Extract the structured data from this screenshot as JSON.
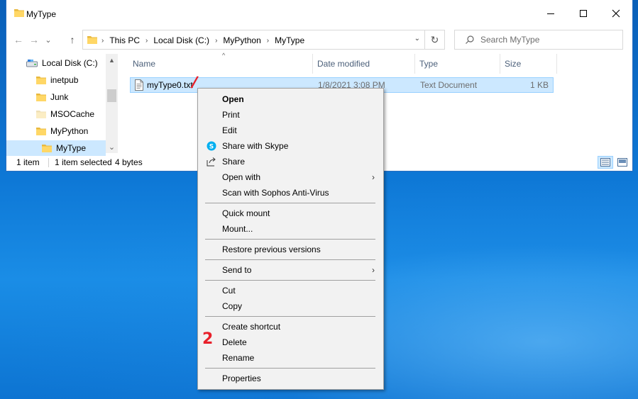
{
  "window": {
    "title": "MyType",
    "controls": {
      "minimize": "—",
      "maximize": "☐",
      "close": "✕"
    }
  },
  "nav": {
    "back": "←",
    "forward": "→",
    "recent": "⌄",
    "up": "↑",
    "breadcrumbs": [
      "This PC",
      "Local Disk (C:)",
      "MyPython",
      "MyType"
    ],
    "breadcrumb_sep": "›",
    "address_dropdown": "⌄",
    "refresh": "↻"
  },
  "search": {
    "placeholder": "Search MyType",
    "value": ""
  },
  "tree": {
    "items": [
      {
        "label": "Local Disk (C:)",
        "type": "drive"
      },
      {
        "label": "inetpub",
        "type": "folder"
      },
      {
        "label": "Junk",
        "type": "folder"
      },
      {
        "label": "MSOCache",
        "type": "folder"
      },
      {
        "label": "MyPython",
        "type": "folder"
      },
      {
        "label": "MyType",
        "type": "folder",
        "selected": true
      }
    ],
    "scroll_up": "▲",
    "scroll_down": "⌄"
  },
  "columns": {
    "name": "Name",
    "date": "Date modified",
    "type": "Type",
    "size": "Size",
    "sort_indicator": "^"
  },
  "files": [
    {
      "name": "myType0.txt",
      "date": "1/8/2021 3:08 PM",
      "type": "Text Document",
      "size": "1 KB"
    }
  ],
  "status": {
    "count": "1 item",
    "selection": "1 item selected",
    "bytes": "4 bytes"
  },
  "context_menu": {
    "open": "Open",
    "print": "Print",
    "edit": "Edit",
    "share_skype": "Share with Skype",
    "share": "Share",
    "open_with": "Open with",
    "scan": "Scan with Sophos Anti-Virus",
    "quick_mount": "Quick mount",
    "mount": "Mount...",
    "restore": "Restore previous versions",
    "send_to": "Send to",
    "cut": "Cut",
    "copy": "Copy",
    "create_shortcut": "Create shortcut",
    "delete": "Delete",
    "rename": "Rename",
    "properties": "Properties",
    "submenu_arrow": "›"
  },
  "annotations": {
    "step1": "/",
    "step2": "2"
  },
  "colors": {
    "selection": "#cce8ff",
    "selection_border": "#99d1ff",
    "folder": "#ffd766",
    "annotation": "#e8202a",
    "skype": "#00aff0"
  }
}
